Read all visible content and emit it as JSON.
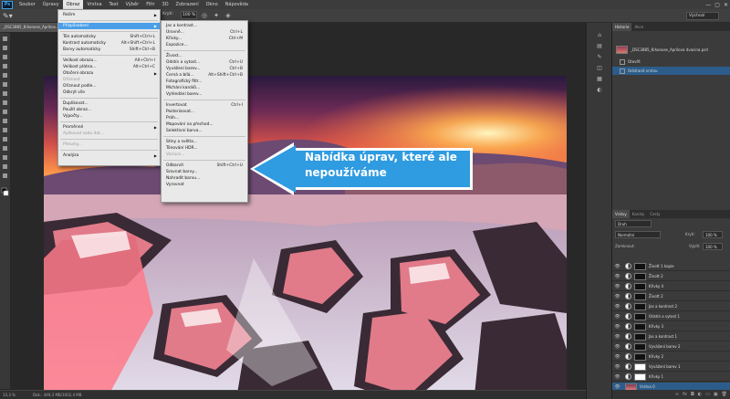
{
  "app": {
    "logo": "Ps",
    "menus": [
      "Soubor",
      "Úpravy",
      "Obraz",
      "Vrstva",
      "Text",
      "Výběr",
      "Filtr",
      "3D",
      "Zobrazení",
      "Okno",
      "Nápověda"
    ],
    "active_menu": "Obraz",
    "window_controls": [
      "—",
      "▢",
      "✕"
    ]
  },
  "options_bar": {
    "mode_label": "Režim:",
    "opacity_label": "Krytí:",
    "opacity_value": "100 %",
    "workspace": "Výchozí"
  },
  "document": {
    "tab_title": "_DSC3885_Krkonose_Apríkov...",
    "zoom": "33,3 %",
    "doc_info": "Dok.: 449,3 MB/1002,4 MB"
  },
  "obraz_menu": {
    "items": [
      {
        "label": "Režim",
        "submenu": true
      },
      {
        "sep": true
      },
      {
        "label": "Přizpůsobení",
        "submenu": true,
        "highlight": true
      },
      {
        "sep": true
      },
      {
        "label": "Tón automaticky",
        "shortcut": "Shift+Ctrl+L"
      },
      {
        "label": "Kontrast automaticky",
        "shortcut": "Alt+Shift+Ctrl+L"
      },
      {
        "label": "Barvy automaticky",
        "shortcut": "Shift+Ctrl+B"
      },
      {
        "sep": true
      },
      {
        "label": "Velikost obrazu...",
        "shortcut": "Alt+Ctrl+I"
      },
      {
        "label": "Velikost plátna...",
        "shortcut": "Alt+Ctrl+C"
      },
      {
        "label": "Otočení obrazu",
        "submenu": true
      },
      {
        "label": "Oříznout",
        "disabled": true
      },
      {
        "label": "Ořiznout podle...",
        "disabled": false
      },
      {
        "label": "Odkrýt vše",
        "disabled": false
      },
      {
        "sep": true
      },
      {
        "label": "Duplikovat..."
      },
      {
        "label": "Použít obraz..."
      },
      {
        "label": "Výpočty..."
      },
      {
        "sep": true
      },
      {
        "label": "Proměnné",
        "submenu": true
      },
      {
        "label": "Aplikovat sadu dat...",
        "disabled": true
      },
      {
        "sep": true
      },
      {
        "label": "Přesahy...",
        "disabled": true
      },
      {
        "sep": true
      },
      {
        "label": "Analýza",
        "submenu": true
      }
    ]
  },
  "upravy_menu": {
    "items": [
      {
        "label": "Jas a kontrast..."
      },
      {
        "label": "Úrovně...",
        "shortcut": "Ctrl+L"
      },
      {
        "label": "Křivky...",
        "shortcut": "Ctrl+M"
      },
      {
        "label": "Expozice..."
      },
      {
        "sep": true
      },
      {
        "label": "Živost..."
      },
      {
        "label": "Odstín a sytost...",
        "shortcut": "Ctrl+U"
      },
      {
        "label": "Vyvážení barev...",
        "shortcut": "Ctrl+B"
      },
      {
        "label": "Černá a bílá...",
        "shortcut": "Alt+Shift+Ctrl+B"
      },
      {
        "label": "Fotografický filtr..."
      },
      {
        "label": "Míchání kanálů..."
      },
      {
        "label": "Vyhledání barev..."
      },
      {
        "sep": true
      },
      {
        "label": "Invertovat",
        "shortcut": "Ctrl+I"
      },
      {
        "label": "Posterizovat..."
      },
      {
        "label": "Práh..."
      },
      {
        "label": "Mapování na přechod..."
      },
      {
        "label": "Selektivní barva..."
      },
      {
        "sep": true
      },
      {
        "label": "Stíny a světla..."
      },
      {
        "label": "Tónování HDR..."
      },
      {
        "label": "Variace...",
        "disabled": true
      },
      {
        "sep": true
      },
      {
        "label": "Odbarvit",
        "shortcut": "Shift+Ctrl+U"
      },
      {
        "label": "Srovnat barvy..."
      },
      {
        "label": "Nahradit barvu..."
      },
      {
        "label": "Vyrovnat"
      }
    ]
  },
  "callout": {
    "text_line1": "Nabídka úprav, které ale",
    "text_line2": "nepoužíváme",
    "color": "#2f9be0"
  },
  "history_panel": {
    "tabs": [
      "Historie",
      "Akce"
    ],
    "snapshot": "_DSC3885_Krkonose_Aprilova dvacina.psd",
    "states": [
      "Otevřít",
      "Odstranit vrstvu"
    ]
  },
  "layers_panel": {
    "tabs": [
      "Vrstvy",
      "Kanály",
      "Cesty"
    ],
    "filter": "Druh",
    "blend_mode": "Normální",
    "opacity_label": "Krytí:",
    "opacity": "100 %",
    "lock_label": "Zamknout:",
    "fill_label": "Výplň:",
    "fill": "100 %",
    "layers": [
      {
        "name": "Živott 1 kopie",
        "mask": "black"
      },
      {
        "name": "Živott 2",
        "mask": "black"
      },
      {
        "name": "Křivky 4",
        "mask": "black"
      },
      {
        "name": "Živott 2",
        "mask": "black"
      },
      {
        "name": "Jas a kontrast 2",
        "mask": "black"
      },
      {
        "name": "Odstín a sytost 1",
        "mask": "black"
      },
      {
        "name": "Křivky 3",
        "mask": "black"
      },
      {
        "name": "Jas a kontrast 1",
        "mask": "black"
      },
      {
        "name": "Vyvážení barev 2",
        "mask": "black"
      },
      {
        "name": "Křivky 2",
        "mask": "black"
      },
      {
        "name": "Vyvážení barev 1",
        "mask": "white"
      },
      {
        "name": "Křivky 1",
        "mask": "white"
      },
      {
        "name": "Vrstva 0",
        "mask": "photo",
        "selected": true
      }
    ]
  }
}
